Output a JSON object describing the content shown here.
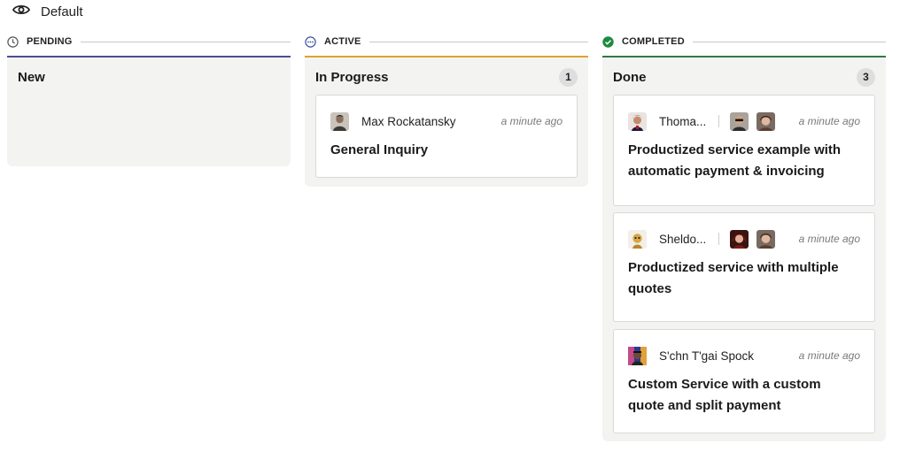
{
  "view": {
    "label": "Default",
    "icon": "eye-icon"
  },
  "columns": [
    {
      "header": "PENDING",
      "icon": "clock-icon",
      "accent": "#4b4d8f",
      "lane": "New",
      "count": ""
    },
    {
      "header": "ACTIVE",
      "icon": "ellipsis-circle-icon",
      "accent": "#d9a52e",
      "lane": "In Progress",
      "count": "1"
    },
    {
      "header": "COMPLETED",
      "icon": "check-circle-icon",
      "accent": "#2f7a46",
      "lane": "Done",
      "count": "3"
    }
  ],
  "cards": {
    "active": [
      {
        "person": "Max Rockatansky",
        "time": "a minute ago",
        "title": "General Inquiry"
      }
    ],
    "completed": [
      {
        "person": "Thoma...",
        "time": "a minute ago",
        "title": "Productized service example with automatic payment & invoicing"
      },
      {
        "person": "Sheldo...",
        "time": "a minute ago",
        "title": "Productized service with multiple quotes"
      },
      {
        "person": "S'chn T'gai Spock",
        "time": "a minute ago",
        "title": "Custom Service with a custom quote and split payment"
      }
    ]
  },
  "colors": {
    "check_green": "#1e8a3f",
    "active_blue": "#3a55a4",
    "lane_bg": "#f3f3f2"
  }
}
